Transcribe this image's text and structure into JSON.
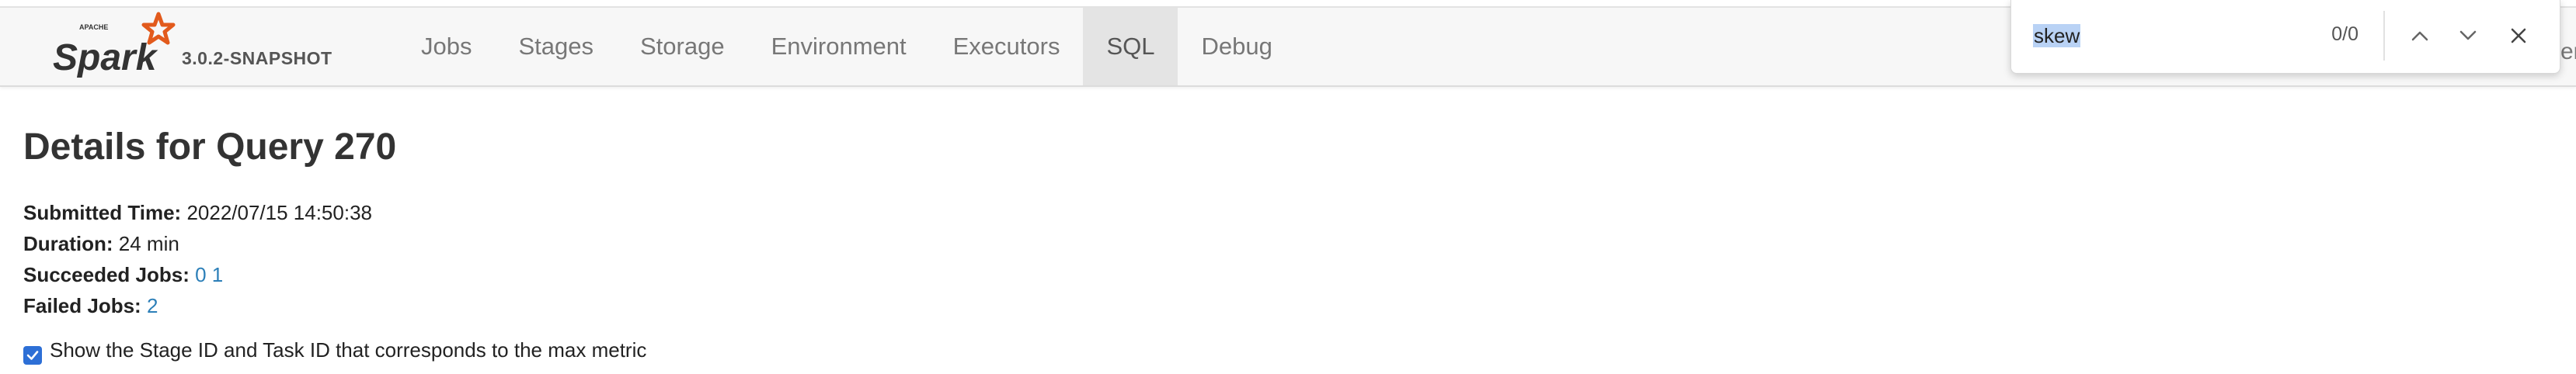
{
  "brand": {
    "logo_alt": "Apache Spark",
    "logo_word": "Spark",
    "logo_small": "APACHE",
    "version": "3.0.2-SNAPSHOT"
  },
  "nav": {
    "items": [
      {
        "label": "Jobs"
      },
      {
        "label": "Stages"
      },
      {
        "label": "Storage"
      },
      {
        "label": "Environment"
      },
      {
        "label": "Executors"
      },
      {
        "label": "SQL",
        "active": true
      },
      {
        "label": "Debug"
      }
    ]
  },
  "find": {
    "query": "skew",
    "count": "0/0"
  },
  "edge_text": "er",
  "page": {
    "title": "Details for Query 270",
    "submitted_label": "Submitted Time:",
    "submitted_value": "2022/07/15 14:50:38",
    "duration_label": "Duration:",
    "duration_value": "24 min",
    "succeeded_label": "Succeeded Jobs:",
    "succeeded_jobs": [
      "0",
      "1"
    ],
    "failed_label": "Failed Jobs:",
    "failed_jobs": [
      "2"
    ],
    "checkbox_label": "Show the Stage ID and Task ID that corresponds to the max metric",
    "checkbox_checked": true
  },
  "colors": {
    "accent_link": "#2c7fb8",
    "checkbox": "#2d6fd6",
    "logo_orange": "#e25a1c",
    "nav_bg": "#f7f7f7",
    "nav_active_bg": "#e4e4e4"
  }
}
